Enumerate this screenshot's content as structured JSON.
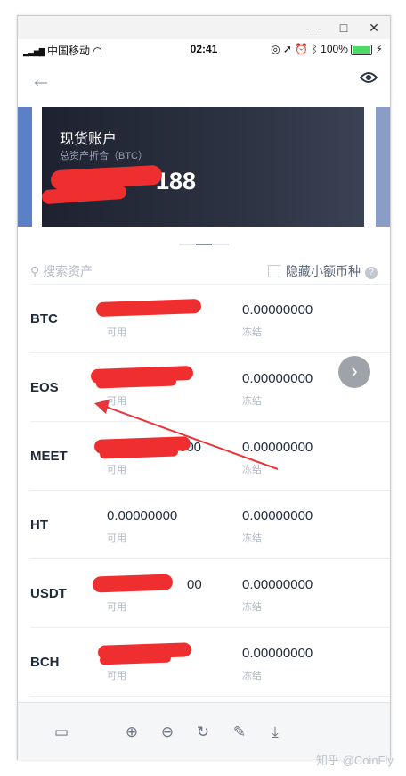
{
  "window": {
    "minimize": "–",
    "maximize": "□",
    "close": "✕"
  },
  "status_bar": {
    "carrier": "中国移动",
    "time": "02:41",
    "battery": "100%",
    "icons": [
      "signal-icon",
      "wifi-icon",
      "lock-icon",
      "location-icon",
      "alarm-icon",
      "bluetooth-icon",
      "battery-icon",
      "charging-icon"
    ]
  },
  "nav": {
    "back_icon": "arrow-left-icon",
    "eye_icon": "eye-icon"
  },
  "account_card": {
    "title": "现货账户",
    "subtitle": "总资产折合（BTC）",
    "amount_visible": "188"
  },
  "search": {
    "placeholder": "搜索资产",
    "hide_small_label": "隐藏小额币种"
  },
  "assets": [
    {
      "symbol": "BTC",
      "available": "",
      "available_label": "可用",
      "frozen": "0.00000000",
      "frozen_label": "冻结"
    },
    {
      "symbol": "EOS",
      "available": "",
      "available_label": "可用",
      "frozen": "0.00000000",
      "frozen_label": "冻结"
    },
    {
      "symbol": "MEET",
      "available": "000",
      "available_label": "可用",
      "frozen": "0.00000000",
      "frozen_label": "冻结"
    },
    {
      "symbol": "HT",
      "available": "0.00000000",
      "available_label": "可用",
      "frozen": "0.00000000",
      "frozen_label": "冻结"
    },
    {
      "symbol": "USDT",
      "available": "00",
      "available_label": "可用",
      "frozen": "0.00000000",
      "frozen_label": "冻结"
    },
    {
      "symbol": "BCH",
      "available": "",
      "available_label": "可用",
      "frozen": "0.00000000",
      "frozen_label": "冻结"
    }
  ],
  "fab": {
    "icon": "chevron-right-icon",
    "glyph": "›"
  },
  "toolbar": {
    "tools": [
      "fit-window-icon",
      "zoom-in-icon",
      "zoom-out-icon",
      "rotate-icon",
      "edit-icon",
      "download-icon"
    ]
  },
  "watermark": "知乎 @CoinFly",
  "colors": {
    "card_dark": "#2d3242",
    "redaction": "#ef2f2f",
    "muted_text": "#b2b9c4"
  }
}
